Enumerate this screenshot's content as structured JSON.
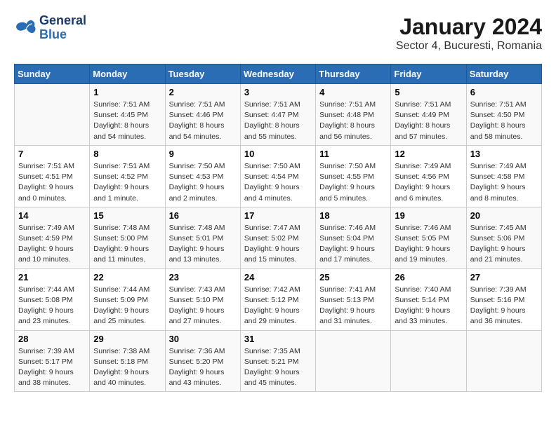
{
  "logo": {
    "line1": "General",
    "line2": "Blue"
  },
  "title": "January 2024",
  "subtitle": "Sector 4, Bucuresti, Romania",
  "days_of_week": [
    "Sunday",
    "Monday",
    "Tuesday",
    "Wednesday",
    "Thursday",
    "Friday",
    "Saturday"
  ],
  "weeks": [
    [
      {
        "day": "",
        "info": ""
      },
      {
        "day": "1",
        "info": "Sunrise: 7:51 AM\nSunset: 4:45 PM\nDaylight: 8 hours\nand 54 minutes."
      },
      {
        "day": "2",
        "info": "Sunrise: 7:51 AM\nSunset: 4:46 PM\nDaylight: 8 hours\nand 54 minutes."
      },
      {
        "day": "3",
        "info": "Sunrise: 7:51 AM\nSunset: 4:47 PM\nDaylight: 8 hours\nand 55 minutes."
      },
      {
        "day": "4",
        "info": "Sunrise: 7:51 AM\nSunset: 4:48 PM\nDaylight: 8 hours\nand 56 minutes."
      },
      {
        "day": "5",
        "info": "Sunrise: 7:51 AM\nSunset: 4:49 PM\nDaylight: 8 hours\nand 57 minutes."
      },
      {
        "day": "6",
        "info": "Sunrise: 7:51 AM\nSunset: 4:50 PM\nDaylight: 8 hours\nand 58 minutes."
      }
    ],
    [
      {
        "day": "7",
        "info": "Sunrise: 7:51 AM\nSunset: 4:51 PM\nDaylight: 9 hours\nand 0 minutes."
      },
      {
        "day": "8",
        "info": "Sunrise: 7:51 AM\nSunset: 4:52 PM\nDaylight: 9 hours\nand 1 minute."
      },
      {
        "day": "9",
        "info": "Sunrise: 7:50 AM\nSunset: 4:53 PM\nDaylight: 9 hours\nand 2 minutes."
      },
      {
        "day": "10",
        "info": "Sunrise: 7:50 AM\nSunset: 4:54 PM\nDaylight: 9 hours\nand 4 minutes."
      },
      {
        "day": "11",
        "info": "Sunrise: 7:50 AM\nSunset: 4:55 PM\nDaylight: 9 hours\nand 5 minutes."
      },
      {
        "day": "12",
        "info": "Sunrise: 7:49 AM\nSunset: 4:56 PM\nDaylight: 9 hours\nand 6 minutes."
      },
      {
        "day": "13",
        "info": "Sunrise: 7:49 AM\nSunset: 4:58 PM\nDaylight: 9 hours\nand 8 minutes."
      }
    ],
    [
      {
        "day": "14",
        "info": "Sunrise: 7:49 AM\nSunset: 4:59 PM\nDaylight: 9 hours\nand 10 minutes."
      },
      {
        "day": "15",
        "info": "Sunrise: 7:48 AM\nSunset: 5:00 PM\nDaylight: 9 hours\nand 11 minutes."
      },
      {
        "day": "16",
        "info": "Sunrise: 7:48 AM\nSunset: 5:01 PM\nDaylight: 9 hours\nand 13 minutes."
      },
      {
        "day": "17",
        "info": "Sunrise: 7:47 AM\nSunset: 5:02 PM\nDaylight: 9 hours\nand 15 minutes."
      },
      {
        "day": "18",
        "info": "Sunrise: 7:46 AM\nSunset: 5:04 PM\nDaylight: 9 hours\nand 17 minutes."
      },
      {
        "day": "19",
        "info": "Sunrise: 7:46 AM\nSunset: 5:05 PM\nDaylight: 9 hours\nand 19 minutes."
      },
      {
        "day": "20",
        "info": "Sunrise: 7:45 AM\nSunset: 5:06 PM\nDaylight: 9 hours\nand 21 minutes."
      }
    ],
    [
      {
        "day": "21",
        "info": "Sunrise: 7:44 AM\nSunset: 5:08 PM\nDaylight: 9 hours\nand 23 minutes."
      },
      {
        "day": "22",
        "info": "Sunrise: 7:44 AM\nSunset: 5:09 PM\nDaylight: 9 hours\nand 25 minutes."
      },
      {
        "day": "23",
        "info": "Sunrise: 7:43 AM\nSunset: 5:10 PM\nDaylight: 9 hours\nand 27 minutes."
      },
      {
        "day": "24",
        "info": "Sunrise: 7:42 AM\nSunset: 5:12 PM\nDaylight: 9 hours\nand 29 minutes."
      },
      {
        "day": "25",
        "info": "Sunrise: 7:41 AM\nSunset: 5:13 PM\nDaylight: 9 hours\nand 31 minutes."
      },
      {
        "day": "26",
        "info": "Sunrise: 7:40 AM\nSunset: 5:14 PM\nDaylight: 9 hours\nand 33 minutes."
      },
      {
        "day": "27",
        "info": "Sunrise: 7:39 AM\nSunset: 5:16 PM\nDaylight: 9 hours\nand 36 minutes."
      }
    ],
    [
      {
        "day": "28",
        "info": "Sunrise: 7:39 AM\nSunset: 5:17 PM\nDaylight: 9 hours\nand 38 minutes."
      },
      {
        "day": "29",
        "info": "Sunrise: 7:38 AM\nSunset: 5:18 PM\nDaylight: 9 hours\nand 40 minutes."
      },
      {
        "day": "30",
        "info": "Sunrise: 7:36 AM\nSunset: 5:20 PM\nDaylight: 9 hours\nand 43 minutes."
      },
      {
        "day": "31",
        "info": "Sunrise: 7:35 AM\nSunset: 5:21 PM\nDaylight: 9 hours\nand 45 minutes."
      },
      {
        "day": "",
        "info": ""
      },
      {
        "day": "",
        "info": ""
      },
      {
        "day": "",
        "info": ""
      }
    ]
  ]
}
